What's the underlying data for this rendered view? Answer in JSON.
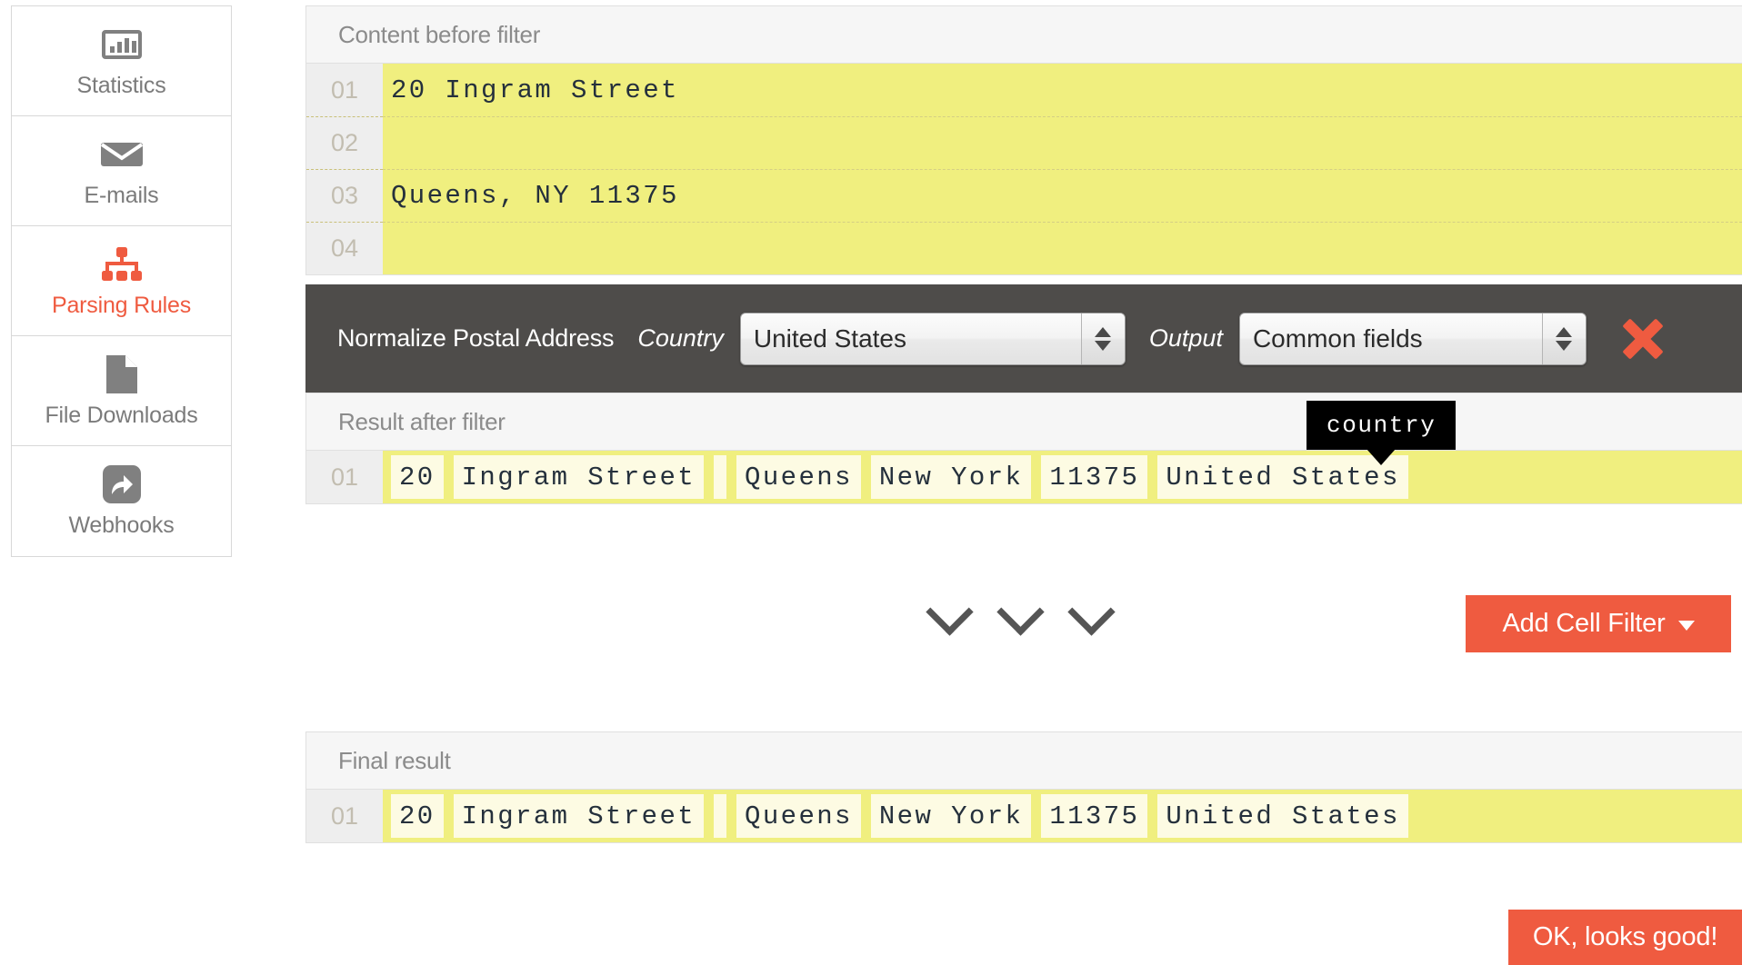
{
  "sidebar": {
    "items": [
      {
        "label": "Statistics",
        "icon": "bar-chart-icon",
        "active": false
      },
      {
        "label": "E-mails",
        "icon": "envelope-icon",
        "active": false
      },
      {
        "label": "Parsing Rules",
        "icon": "sitemap-icon",
        "active": true
      },
      {
        "label": "File Downloads",
        "icon": "file-icon",
        "active": false
      },
      {
        "label": "Webhooks",
        "icon": "share-icon",
        "active": false
      }
    ]
  },
  "before_filter": {
    "header": "Content before filter",
    "lines": [
      {
        "no": "01",
        "text": "20 Ingram Street"
      },
      {
        "no": "02",
        "text": ""
      },
      {
        "no": "03",
        "text": "Queens, NY 11375"
      },
      {
        "no": "04",
        "text": ""
      }
    ]
  },
  "filter_bar": {
    "title": "Normalize Postal Address",
    "country_label": "Country",
    "country_value": "United States",
    "output_label": "Output",
    "output_value": "Common fields",
    "delete_icon": "close-x-icon"
  },
  "after_filter": {
    "header": "Result after filter",
    "row_no": "01",
    "cells": [
      "20",
      "Ingram Street",
      "",
      "Queens",
      "New York",
      "11375",
      "United States"
    ]
  },
  "tooltip": {
    "text": "country"
  },
  "flow": {
    "chevron_icon": "chevron-down-icon",
    "chevron_count": 3
  },
  "actions": {
    "add_cell_filter": "Add Cell Filter",
    "ok_button": "OK, looks good!"
  },
  "final_result": {
    "header": "Final result",
    "row_no": "01",
    "cells": [
      "20",
      "Ingram Street",
      "",
      "Queens",
      "New York",
      "11375",
      "United States"
    ]
  },
  "colors": {
    "accent": "#ef5b40",
    "filter_bar_bg": "#4e4c4a",
    "row_highlight": "#f0ef7f",
    "cell_bg": "#fdfbe3",
    "panel_header_bg": "#f6f6f6",
    "muted_text": "#8b8b8b"
  }
}
